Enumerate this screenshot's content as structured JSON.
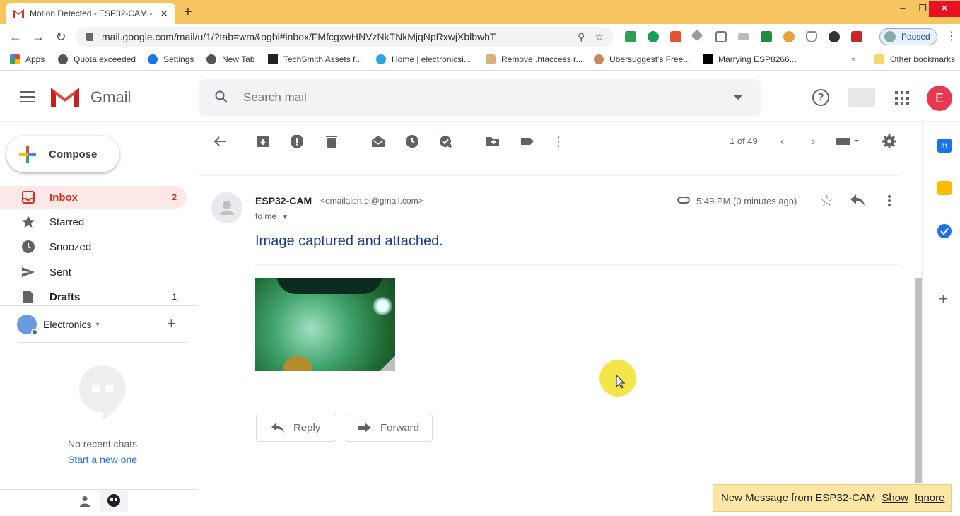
{
  "browser": {
    "tab_title": "Motion Detected - ESP32-CAM -",
    "url": "mail.google.com/mail/u/1/?tab=wm&ogbl#inbox/FMfcgxwHNVzNkTNkMjqNpRxwjXblbwhT",
    "profile_status": "Paused",
    "bookmarks": [
      {
        "label": "Apps",
        "icon": "apps-grid-icon"
      },
      {
        "label": "Quota exceeded",
        "icon": "globe-icon"
      },
      {
        "label": "Settings",
        "icon": "gear-icon"
      },
      {
        "label": "New Tab",
        "icon": "globe-icon"
      },
      {
        "label": "TechSmith Assets f...",
        "icon": "x-logo-icon"
      },
      {
        "label": "Home | electronicsi...",
        "icon": "site-icon"
      },
      {
        "label": "Remove .htaccess r...",
        "icon": "site-icon"
      },
      {
        "label": "Ubersuggest's Free...",
        "icon": "avatar-icon"
      },
      {
        "label": "Marrying ESP8266...",
        "icon": "medium-logo-icon"
      }
    ],
    "bookmarks_overflow": "»",
    "other_bookmarks": "Other bookmarks"
  },
  "gmail": {
    "brand": "Gmail",
    "search_placeholder": "Search mail",
    "avatar_letter": "E"
  },
  "nav": {
    "compose_label": "Compose",
    "items": [
      {
        "label": "Inbox",
        "count": "2",
        "icon": "inbox-icon"
      },
      {
        "label": "Starred",
        "count": "",
        "icon": "star-icon"
      },
      {
        "label": "Snoozed",
        "count": "",
        "icon": "clock-icon"
      },
      {
        "label": "Sent",
        "count": "",
        "icon": "send-icon"
      },
      {
        "label": "Drafts",
        "count": "1",
        "icon": "draft-icon"
      }
    ],
    "user_name": "Electronics",
    "no_recent": "No recent chats",
    "start_new": "Start a new one"
  },
  "toolbar": {
    "pager": "1 of 49"
  },
  "message": {
    "sender_name": "ESP32-CAM",
    "sender_email": "<emailalert.ei@gmail.com>",
    "to": "to me",
    "time": "5:49 PM (0 minutes ago)",
    "body": "Image captured and attached.",
    "reply_label": "Reply",
    "forward_label": "Forward"
  },
  "notification": {
    "text": "New Message from ESP32-CAM",
    "show": "Show",
    "ignore": "Ignore"
  },
  "colors": {
    "tabstrip": "#f7c55f",
    "inbox_highlight": "#fce8e6",
    "inbox_text": "#d93025",
    "body_text": "#1c3d8e",
    "notify_bg": "#fbe6a6",
    "cursor_highlight": "#f4e64a"
  }
}
